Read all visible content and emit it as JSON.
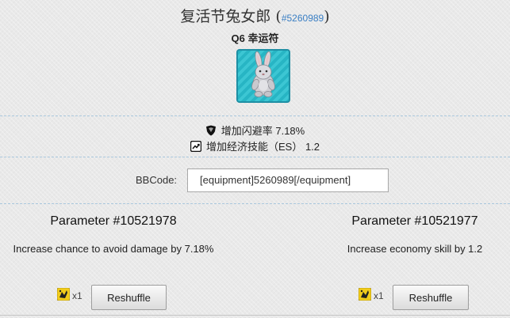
{
  "header": {
    "title": "复活节兔女郎",
    "title_open": "(",
    "id_link": "#5260989",
    "title_close": ")"
  },
  "item": {
    "quality": "Q6 幸运符",
    "icon": "bunny-plush-icon",
    "frame_color": "#27b5c4"
  },
  "bonuses": [
    {
      "icon": "shield-icon",
      "text": "增加闪避率 7.18%"
    },
    {
      "icon": "trend-up-icon",
      "text": "增加经济技能（ES） 1.2"
    }
  ],
  "bbcode": {
    "label": "BBCode:",
    "value": "[equipment]5260989[/equipment]"
  },
  "parameters": [
    {
      "title": "Parameter #10521978",
      "description": "Increase chance to avoid damage by 7.18%",
      "cost_icon": "dice-icon",
      "cost": "x1",
      "button": "Reshuffle"
    },
    {
      "title": "Parameter #10521977",
      "description": "Increase economy skill by 1.2",
      "cost_icon": "dice-icon",
      "cost": "x1",
      "button": "Reshuffle"
    }
  ],
  "colors": {
    "link": "#3a7fc4",
    "separator": "#a9c7dd",
    "dice": "#f2cc1b"
  }
}
